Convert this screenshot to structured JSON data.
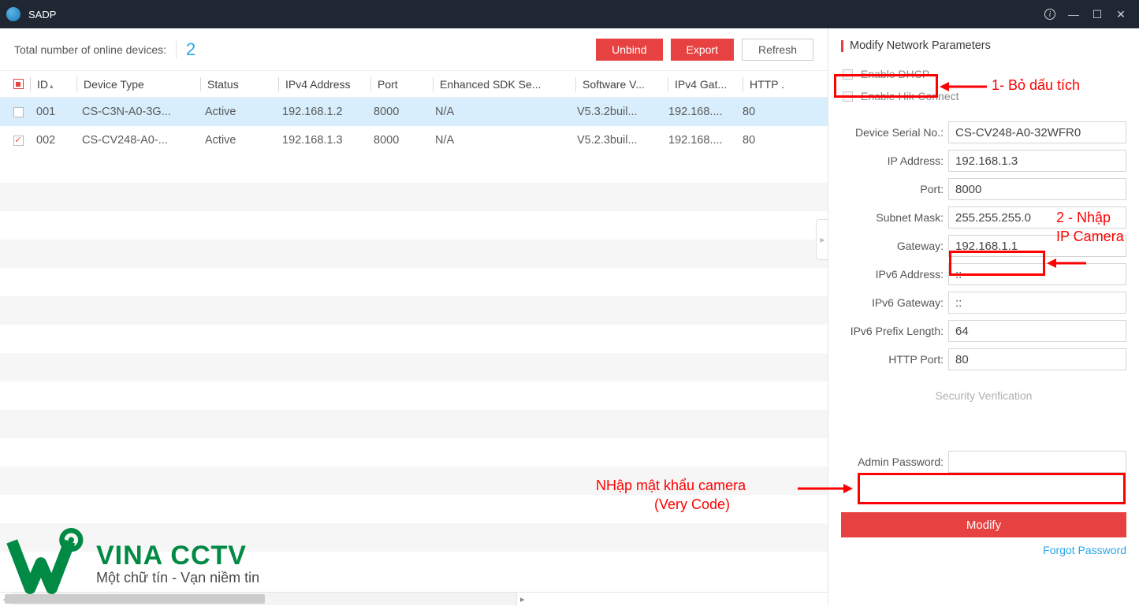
{
  "titlebar": {
    "app_name": "SADP"
  },
  "toolbar": {
    "total_label": "Total number of online devices:",
    "total_count": "2",
    "unbind": "Unbind",
    "export": "Export",
    "refresh": "Refresh"
  },
  "table": {
    "headers": {
      "id": "ID",
      "device_type": "Device Type",
      "status": "Status",
      "ipv4": "IPv4 Address",
      "port": "Port",
      "sdk": "Enhanced SDK Se...",
      "software": "Software V...",
      "gateway": "IPv4 Gat...",
      "http": "HTTP ."
    },
    "rows": [
      {
        "checked": false,
        "id": "001",
        "device_type": "CS-C3N-A0-3G...",
        "status": "Active",
        "ipv4": "192.168.1.2",
        "port": "8000",
        "sdk": "N/A",
        "software": "V5.3.2buil...",
        "gateway": "192.168....",
        "http": "80",
        "selected": true
      },
      {
        "checked": true,
        "id": "002",
        "device_type": "CS-CV248-A0-...",
        "status": "Active",
        "ipv4": "192.168.1.3",
        "port": "8000",
        "sdk": "N/A",
        "software": "V5.2.3buil...",
        "gateway": "192.168....",
        "http": "80",
        "selected": false
      }
    ]
  },
  "panel": {
    "title": "Modify Network Parameters",
    "enable_dhcp": "Enable DHCP",
    "enable_hik": "Enable Hik-Connect",
    "fields": {
      "serial_label": "Device Serial No.:",
      "serial_value": "CS-CV248-A0-32WFR0",
      "ip_label": "IP Address:",
      "ip_value": "192.168.1.3",
      "port_label": "Port:",
      "port_value": "8000",
      "subnet_label": "Subnet Mask:",
      "subnet_value": "255.255.255.0",
      "gateway_label": "Gateway:",
      "gateway_value": "192.168.1.1",
      "ipv6_label": "IPv6 Address:",
      "ipv6_value": "::",
      "ipv6gw_label": "IPv6 Gateway:",
      "ipv6gw_value": "::",
      "ipv6len_label": "IPv6 Prefix Length:",
      "ipv6len_value": "64",
      "http_label": "HTTP Port:",
      "http_value": "80",
      "admin_label": "Admin Password:",
      "admin_value": ""
    },
    "security_verification": "Security Verification",
    "modify": "Modify",
    "forgot": "Forgot Password"
  },
  "annotations": {
    "a1": "1- Bỏ dấu tích",
    "a2_line1": "2 - Nhập",
    "a2_line2": "IP Camera",
    "a3_line1": "NHập mật khẩu camera",
    "a3_line2": "(Very Code)"
  },
  "watermark": {
    "brand": "VINA CCTV",
    "slogan": "Một chữ tín - Vạn niềm tin"
  }
}
